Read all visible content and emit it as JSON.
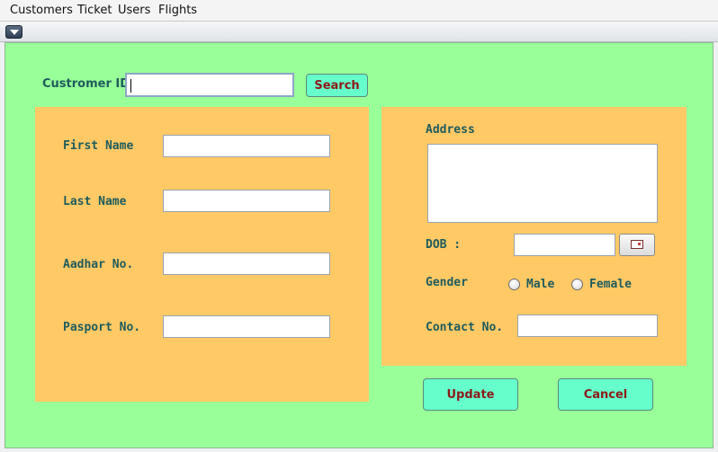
{
  "menubar": {
    "items": [
      "Customers",
      "Ticket",
      "Users",
      "Flights"
    ]
  },
  "search": {
    "label": "Custromer ID",
    "value": "",
    "button_label": "Search"
  },
  "personal": {
    "first_name_label": "First Name",
    "last_name_label": "Last Name",
    "aadhar_label": "Aadhar No.",
    "passport_label": "Pasport No.",
    "first_name": "",
    "last_name": "",
    "aadhar": "",
    "passport": ""
  },
  "contact": {
    "address_label": "Address",
    "address": "",
    "dob_label": "DOB :",
    "dob": "",
    "gender_label": "Gender",
    "gender_options": [
      "Male",
      "Female"
    ],
    "contact_label": "Contact No.",
    "contact": ""
  },
  "actions": {
    "update_label": "Update",
    "cancel_label": "Cancel"
  },
  "colors": {
    "background": "#99ff99",
    "panel": "#ffc966",
    "button": "#66ffcc",
    "button_text": "#8b1a1a",
    "label_text": "#1f5c5c"
  },
  "icons": {
    "system_menu": "chevron-down-icon",
    "date_picker": "calendar-icon"
  }
}
